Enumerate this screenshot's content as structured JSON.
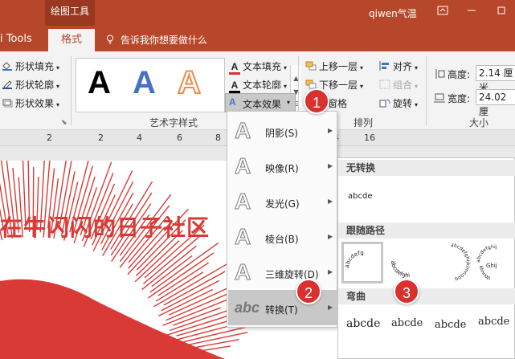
{
  "titlebar": {
    "context_tool": "绘图工具",
    "user": "qiwen气温"
  },
  "tabs": {
    "tools_fragment": "i Tools",
    "format": "格式",
    "tell_me": "告诉我你想要做什么"
  },
  "ribbon": {
    "shape_styles": {
      "fill": "形状填充",
      "outline": "形状轮廓",
      "effects": "形状效果"
    },
    "wordart": {
      "samples": [
        {
          "glyph": "A",
          "color": "#000000"
        },
        {
          "glyph": "A",
          "color": "#4472c4"
        },
        {
          "glyph": "A",
          "color": "#f4b183"
        }
      ],
      "text_fill": "文本填充",
      "text_outline": "文本轮廓",
      "text_effects": "文本效果",
      "group_label": "艺术字样式"
    },
    "arrange": {
      "bring_forward": "上移一层",
      "send_backward": "下移一层",
      "selection_pane": "择窗格",
      "align": "对齐",
      "group": "组合",
      "rotate": "旋转",
      "group_label": "排列"
    },
    "size": {
      "height_label": "高度:",
      "height_value": "2.14 厘米",
      "width_label": "宽度:",
      "width_value": "24.02 厘",
      "group_label": "大小"
    }
  },
  "ruler": {
    "ticks": [
      "2",
      "2",
      "4",
      "6",
      "8",
      "10",
      "12",
      "14",
      "16"
    ]
  },
  "slide": {
    "title_text": "在牛闪闪的日子社区"
  },
  "effects_menu": {
    "items": [
      {
        "label": "阴影(S)",
        "icon": "A"
      },
      {
        "label": "映像(R)",
        "icon": "A"
      },
      {
        "label": "发光(G)",
        "icon": "A"
      },
      {
        "label": "棱台(B)",
        "icon": "A"
      },
      {
        "label": "三维旋转(D)",
        "icon": "A"
      },
      {
        "label": "转换(T)",
        "icon": "abc"
      }
    ]
  },
  "transform_menu": {
    "no_transform": "无转换",
    "no_transform_sample": "abcde",
    "follow_path": "跟随路径",
    "warp": "弯曲",
    "warp_samples": [
      "abcde",
      "abcde",
      "abcde",
      "abcde"
    ]
  },
  "callouts": [
    "1",
    "2",
    "3"
  ],
  "colors": {
    "brand": "#b7472a",
    "accent": "#d9322e",
    "slide_text": "#d93a36"
  }
}
